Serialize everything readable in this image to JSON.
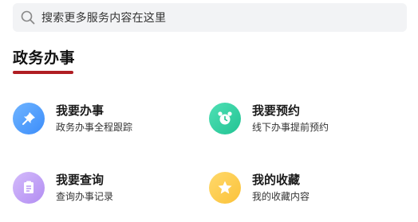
{
  "search": {
    "placeholder": "搜索更多服务内容在这里",
    "icon": "search-icon"
  },
  "section": {
    "title": "政务办事",
    "accent_color": "#b01e23"
  },
  "tiles": [
    {
      "title": "我要办事",
      "subtitle": "政务办事全程跟踪",
      "icon": "pin-icon",
      "color": "#3c8dfa"
    },
    {
      "title": "我要预约",
      "subtitle": "线下办事提前预约",
      "icon": "alarm-clock-icon",
      "color": "#22c393"
    },
    {
      "title": "我要查询",
      "subtitle": "查询办事记录",
      "icon": "document-icon",
      "color": "#b28df2"
    },
    {
      "title": "我的收藏",
      "subtitle": "我的收藏内容",
      "icon": "star-icon",
      "color": "#fbc23a"
    }
  ]
}
